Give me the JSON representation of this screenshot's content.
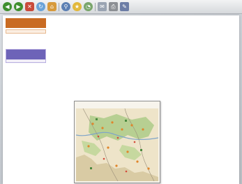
{
  "browser": {
    "buttons": [
      {
        "name": "back-button",
        "icon": "left-arrow-icon",
        "glyph": "◀"
      },
      {
        "name": "forward-button",
        "icon": "right-arrow-icon",
        "glyph": "▶"
      },
      {
        "name": "stop-button",
        "icon": "stop-icon",
        "glyph": "✕"
      },
      {
        "name": "refresh-button",
        "icon": "refresh-icon",
        "glyph": "↻"
      },
      {
        "name": "home-button",
        "icon": "home-icon",
        "glyph": "⌂"
      },
      {
        "name": "search-button",
        "icon": "search-icon",
        "glyph": "⚲"
      },
      {
        "name": "favorites-button",
        "icon": "star-icon",
        "glyph": "★"
      },
      {
        "name": "history-button",
        "icon": "history-icon",
        "glyph": "◔"
      },
      {
        "name": "mail-button",
        "icon": "mail-icon",
        "glyph": "✉"
      },
      {
        "name": "print-button",
        "icon": "printer-icon",
        "glyph": "⎙"
      },
      {
        "name": "edit-button",
        "icon": "edit-icon",
        "glyph": "✎"
      }
    ]
  },
  "sidebar": {
    "menu_header": "",
    "menu_items": [
      "",
      "",
      "",
      "",
      "",
      ""
    ],
    "section_header": "",
    "section_items": [
      "",
      "",
      "",
      "",
      "",
      "",
      ""
    ]
  },
  "content": {
    "paragraphs": [
      "",
      ""
    ],
    "links_heading": "",
    "links": [
      "",
      "",
      "",
      "",
      "",
      "",
      ""
    ]
  },
  "map": {
    "title_lines": [
      "",
      ""
    ]
  },
  "colors": {
    "sidebar_accent": "#c96b22",
    "section_accent": "#6d63b8",
    "link_color": "#c0392b",
    "map_background": "#f7f4ec"
  }
}
